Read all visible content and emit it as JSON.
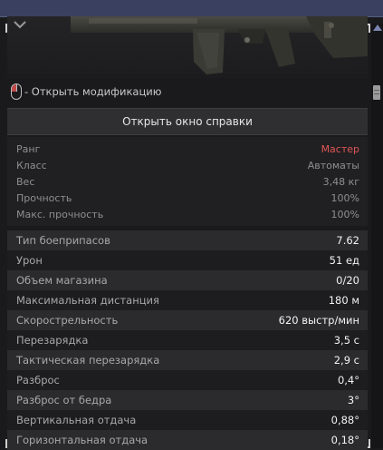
{
  "hint": {
    "open_mod": "- Открыть модификацию"
  },
  "help_button": "Открыть окно справки",
  "general": [
    {
      "label": "Ранг",
      "value": "Мастер"
    },
    {
      "label": "Класс",
      "value": "Автоматы"
    },
    {
      "label": "Вес",
      "value": "3,48 кг"
    },
    {
      "label": "Прочность",
      "value": "100%"
    },
    {
      "label": "Макс. прочность",
      "value": "100%"
    }
  ],
  "stats": [
    {
      "label": "Тип боеприпасов",
      "value": "7.62"
    },
    {
      "label": "Урон",
      "value": "51 ед"
    },
    {
      "label": "Объем магазина",
      "value": "0/20"
    },
    {
      "label": "Максимальная дистанция",
      "value": "180 м"
    },
    {
      "label": "Скорострельность",
      "value": "620 выстр/мин"
    },
    {
      "label": "Перезарядка",
      "value": "3,5 с"
    },
    {
      "label": "Тактическая перезарядка",
      "value": "2,9 с"
    },
    {
      "label": "Разброс",
      "value": "0,4°"
    },
    {
      "label": "Разброс от бедра",
      "value": "3°"
    },
    {
      "label": "Вертикальная отдача",
      "value": "0,88°"
    },
    {
      "label": "Горизонтальная отдача",
      "value": "0,18°"
    }
  ],
  "colors": {
    "rank": "#e25555",
    "banner": "#3a4060"
  }
}
